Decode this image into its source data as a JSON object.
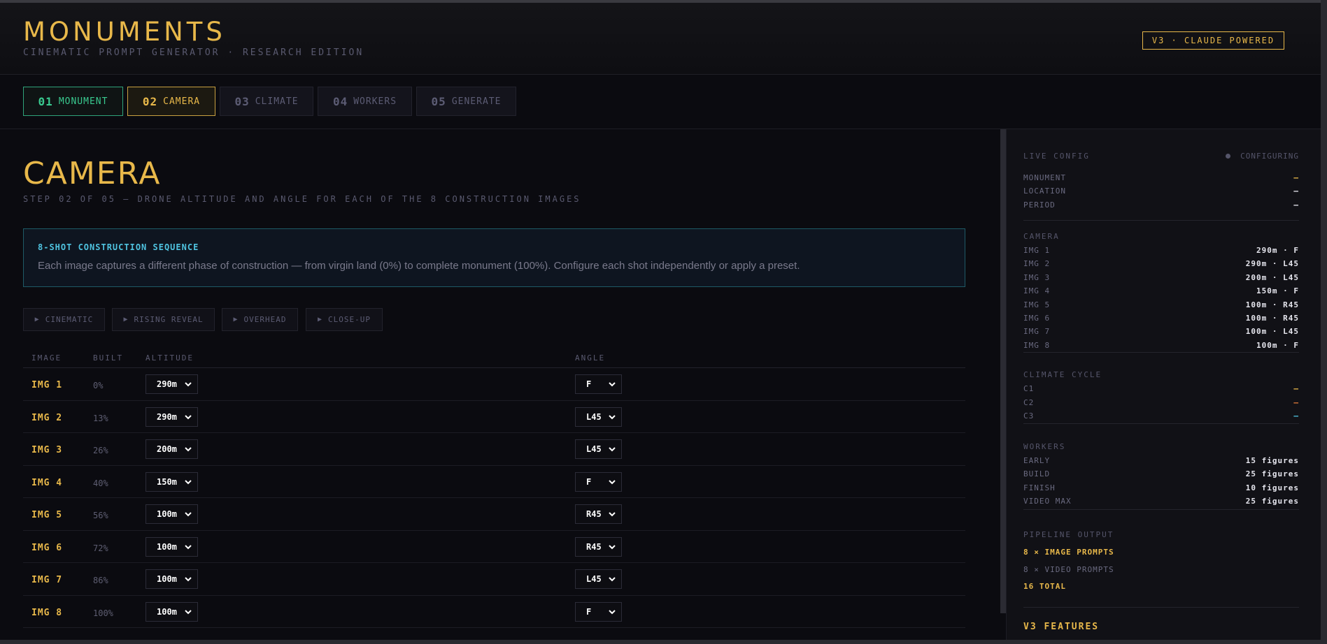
{
  "header": {
    "title": "MONUMENTS",
    "subtitle": "CINEMATIC PROMPT GENERATOR · RESEARCH EDITION",
    "badge": "V3 · CLAUDE POWERED"
  },
  "tabs": [
    {
      "num": "01",
      "label": "MONUMENT",
      "state": "done"
    },
    {
      "num": "02",
      "label": "CAMERA",
      "state": "active"
    },
    {
      "num": "03",
      "label": "CLIMATE",
      "state": "idle"
    },
    {
      "num": "04",
      "label": "WORKERS",
      "state": "idle"
    },
    {
      "num": "05",
      "label": "GENERATE",
      "state": "idle"
    }
  ],
  "page": {
    "title": "CAMERA",
    "subtitle": "STEP 02 OF 05 — DRONE ALTITUDE AND ANGLE FOR EACH OF THE 8 CONSTRUCTION IMAGES"
  },
  "info": {
    "title": "8-SHOT CONSTRUCTION SEQUENCE",
    "text": "Each image captures a different phase of construction — from virgin land (0%) to complete monument (100%). Configure each shot independently or apply a preset."
  },
  "presets": [
    "CINEMATIC",
    "RISING REVEAL",
    "OVERHEAD",
    "CLOSE-UP"
  ],
  "table": {
    "headers": {
      "image": "IMAGE",
      "built": "BUILT",
      "altitude": "ALTITUDE",
      "angle": "ANGLE"
    },
    "rows": [
      {
        "image": "IMG 1",
        "built": "0%",
        "altitude": "290m",
        "angle": "F"
      },
      {
        "image": "IMG 2",
        "built": "13%",
        "altitude": "290m",
        "angle": "L45"
      },
      {
        "image": "IMG 3",
        "built": "26%",
        "altitude": "200m",
        "angle": "L45"
      },
      {
        "image": "IMG 4",
        "built": "40%",
        "altitude": "150m",
        "angle": "F"
      },
      {
        "image": "IMG 5",
        "built": "56%",
        "altitude": "100m",
        "angle": "R45"
      },
      {
        "image": "IMG 6",
        "built": "72%",
        "altitude": "100m",
        "angle": "R45"
      },
      {
        "image": "IMG 7",
        "built": "86%",
        "altitude": "100m",
        "angle": "L45"
      },
      {
        "image": "IMG 8",
        "built": "100%",
        "altitude": "100m",
        "angle": "F"
      }
    ]
  },
  "sidebar": {
    "title": "LIVE CONFIG",
    "status": "CONFIGURING",
    "general": [
      {
        "k": "MONUMENT",
        "v": "—"
      },
      {
        "k": "LOCATION",
        "v": "—"
      },
      {
        "k": "PERIOD",
        "v": "—"
      }
    ],
    "camera_label": "CAMERA",
    "camera": [
      {
        "k": "IMG 1",
        "v": "290m · F"
      },
      {
        "k": "IMG 2",
        "v": "290m · L45"
      },
      {
        "k": "IMG 3",
        "v": "200m · L45"
      },
      {
        "k": "IMG 4",
        "v": "150m · F"
      },
      {
        "k": "IMG 5",
        "v": "100m · R45"
      },
      {
        "k": "IMG 6",
        "v": "100m · R45"
      },
      {
        "k": "IMG 7",
        "v": "100m · L45"
      },
      {
        "k": "IMG 8",
        "v": "100m · F"
      }
    ],
    "climate_label": "CLIMATE CYCLE",
    "climate": [
      {
        "k": "C1",
        "v": "—",
        "color": "#e8b84a"
      },
      {
        "k": "C2",
        "v": "—",
        "color": "#e07a3a"
      },
      {
        "k": "C3",
        "v": "—",
        "color": "#4fc3e0"
      }
    ],
    "workers_label": "WORKERS",
    "workers": [
      {
        "k": "EARLY",
        "v": "15 figures"
      },
      {
        "k": "BUILD",
        "v": "25 figures"
      },
      {
        "k": "FINISH",
        "v": "10 figures"
      },
      {
        "k": "VIDEO MAX",
        "v": "25 figures"
      }
    ],
    "pipeline_label": "PIPELINE OUTPUT",
    "pipeline": {
      "image_prompts": "8 × IMAGE PROMPTS",
      "video_prompts": "8 × VIDEO PROMPTS",
      "total": "16 TOTAL"
    },
    "features_label": "V3 FEATURES"
  },
  "colors": {
    "accent": "#e8b84a",
    "done": "#39c98f",
    "info": "#4fc3e0",
    "background": "#0b0b10"
  }
}
